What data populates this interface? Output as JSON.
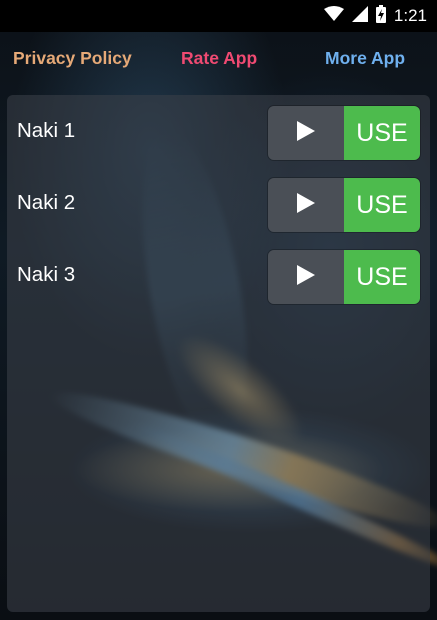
{
  "status_bar": {
    "time": "1:21",
    "icons": [
      "wifi-icon",
      "signal-icon",
      "battery-charging-icon"
    ]
  },
  "header": {
    "privacy_label": "Privacy Policy",
    "rate_label": "Rate App",
    "more_label": "More App",
    "colors": {
      "privacy": "#e6a977",
      "rate": "#f04a72",
      "more": "#6fb0ee"
    }
  },
  "items": [
    {
      "label": "Naki 1",
      "use_label": "USE",
      "play_icon": "play-icon"
    },
    {
      "label": "Naki 2",
      "use_label": "USE",
      "play_icon": "play-icon"
    },
    {
      "label": "Naki 3",
      "use_label": "USE",
      "play_icon": "play-icon"
    }
  ],
  "colors": {
    "use_button": "#4dbb4d",
    "play_button": "#4a4f56"
  }
}
